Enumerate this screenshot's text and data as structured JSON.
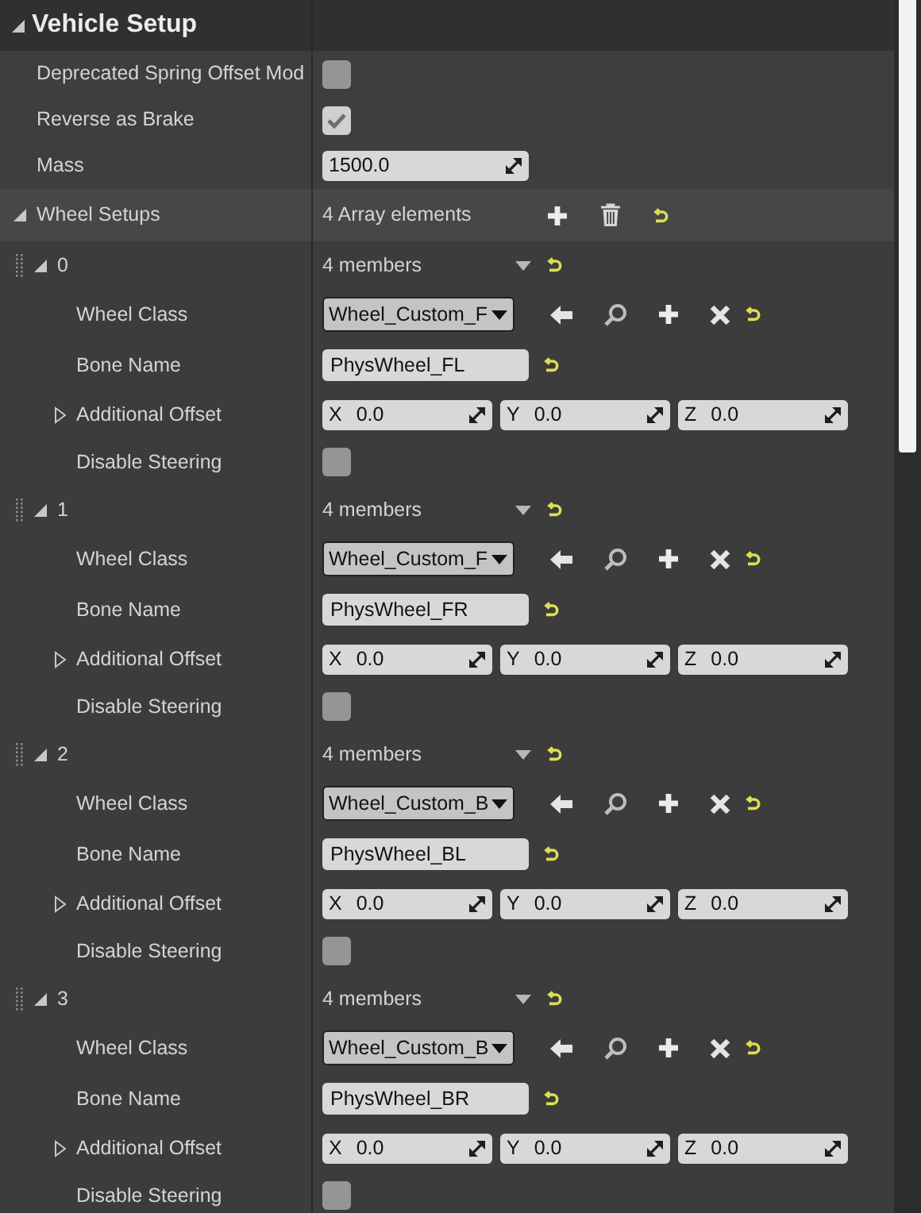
{
  "section": {
    "title": "Vehicle Setup",
    "expanded": true
  },
  "properties": [
    {
      "kind": "checkbox",
      "label": "Deprecated Spring Offset Mod",
      "checked": false
    },
    {
      "kind": "checkbox",
      "label": "Reverse as Brake",
      "checked": true
    },
    {
      "kind": "number",
      "label": "Mass",
      "value": "1500.0"
    }
  ],
  "wheel_setups": {
    "label": "Wheel Setups",
    "expanded": true,
    "summary": "4 Array elements",
    "elements": [
      {
        "index": "0",
        "expanded": true,
        "summary": "4 members",
        "wheel_class": {
          "label": "Wheel Class",
          "value": "Wheel_Custom_F"
        },
        "bone_name": {
          "label": "Bone Name",
          "value": "PhysWheel_FL"
        },
        "additional_offset": {
          "label": "Additional Offset",
          "expanded": false,
          "components": [
            {
              "axis": "X",
              "value": "0.0"
            },
            {
              "axis": "Y",
              "value": "0.0"
            },
            {
              "axis": "Z",
              "value": "0.0"
            }
          ]
        },
        "disable_steering": {
          "label": "Disable Steering",
          "checked": false
        }
      },
      {
        "index": "1",
        "expanded": true,
        "summary": "4 members",
        "wheel_class": {
          "label": "Wheel Class",
          "value": "Wheel_Custom_F"
        },
        "bone_name": {
          "label": "Bone Name",
          "value": "PhysWheel_FR"
        },
        "additional_offset": {
          "label": "Additional Offset",
          "expanded": false,
          "components": [
            {
              "axis": "X",
              "value": "0.0"
            },
            {
              "axis": "Y",
              "value": "0.0"
            },
            {
              "axis": "Z",
              "value": "0.0"
            }
          ]
        },
        "disable_steering": {
          "label": "Disable Steering",
          "checked": false
        }
      },
      {
        "index": "2",
        "expanded": true,
        "summary": "4 members",
        "wheel_class": {
          "label": "Wheel Class",
          "value": "Wheel_Custom_B"
        },
        "bone_name": {
          "label": "Bone Name",
          "value": "PhysWheel_BL"
        },
        "additional_offset": {
          "label": "Additional Offset",
          "expanded": false,
          "components": [
            {
              "axis": "X",
              "value": "0.0"
            },
            {
              "axis": "Y",
              "value": "0.0"
            },
            {
              "axis": "Z",
              "value": "0.0"
            }
          ]
        },
        "disable_steering": {
          "label": "Disable Steering",
          "checked": false
        }
      },
      {
        "index": "3",
        "expanded": true,
        "summary": "4 members",
        "wheel_class": {
          "label": "Wheel Class",
          "value": "Wheel_Custom_B"
        },
        "bone_name": {
          "label": "Bone Name",
          "value": "PhysWheel_BR"
        },
        "additional_offset": {
          "label": "Additional Offset",
          "expanded": false,
          "components": [
            {
              "axis": "X",
              "value": "0.0"
            },
            {
              "axis": "Y",
              "value": "0.0"
            },
            {
              "axis": "Z",
              "value": "0.0"
            }
          ]
        },
        "disable_steering": {
          "label": "Disable Steering",
          "checked": false
        }
      }
    ]
  }
}
